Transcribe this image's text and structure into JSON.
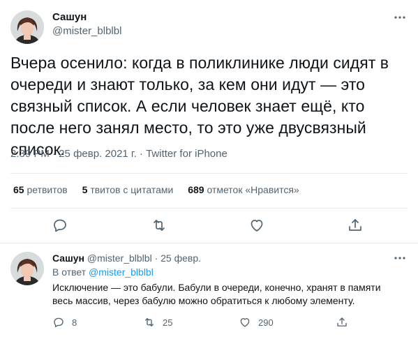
{
  "main_tweet": {
    "author_name": "Сашун",
    "author_handle": "@mister_blblbl",
    "text": "Вчера осенило: когда в поликлинике люди сидят в очереди и знают только, за кем они идут — это связный список. А если человек знает ещё, кто после него занял место, то это уже двусвязный список.",
    "time": "2:39 PM",
    "date": "25 февр. 2021 г.",
    "separator": "·",
    "source": "Twitter for iPhone",
    "stats": {
      "retweets_count": "65",
      "retweets_label": "ретвитов",
      "quotes_count": "5",
      "quotes_label": "твитов с цитатами",
      "likes_count": "689",
      "likes_label": "отметок «Нравится»"
    },
    "actions": [
      "reply-icon",
      "retweet-icon",
      "like-icon",
      "share-icon"
    ]
  },
  "reply_tweet": {
    "author_name": "Сашун",
    "author_handle": "@mister_blblbl",
    "separator": "·",
    "date": "25 февр.",
    "replying_prefix": "В ответ",
    "replying_to": "@mister_blblbl",
    "text": "Исключение — это бабули. Бабули в очереди, конечно, хранят в памяти весь массив, через бабулю можно обратиться к любому элементу.",
    "reply_count": "8",
    "retweet_count": "25",
    "like_count": "290"
  },
  "colors": {
    "text_primary": "#0f1419",
    "text_secondary": "#536471",
    "link": "#1d9bf0",
    "divider": "#e6ecf0"
  }
}
